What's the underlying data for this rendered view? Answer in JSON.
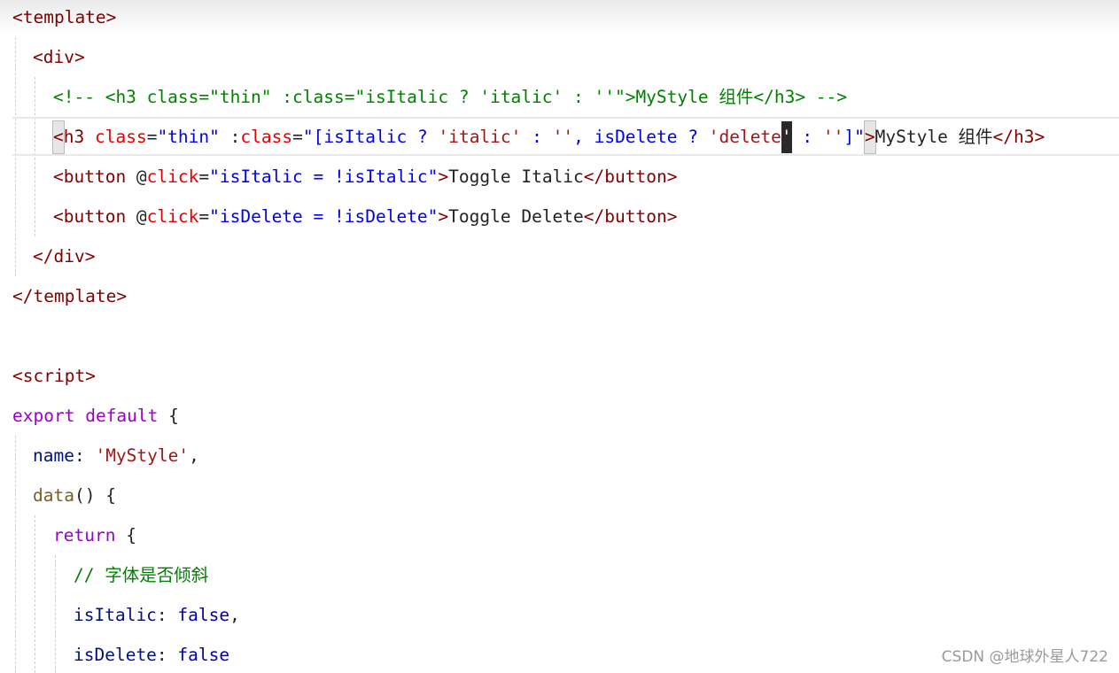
{
  "code": {
    "line1": "<template>",
    "line2": "<div>",
    "line3": "<!-- <h3 class=\"thin\" :class=\"isItalic ? 'italic' : ''\">MyStyle 组件</h3> -->",
    "line4": {
      "open_bracket": "<",
      "tag": "h3",
      "space": " ",
      "attr_class": "class",
      "eq1": "=",
      "val_thin": "\"thin\"",
      "space2": " ",
      "colon": ":",
      "attr_bind": "class",
      "eq2": "=",
      "val_open": "\"[isItalic ? ",
      "str_italic": "'italic'",
      "mid1": " : ",
      "str_empty1": "''",
      "mid2": ", isDelete ? ",
      "str_delete": "'delete",
      "cursor_char": "'",
      "mid3": " : ",
      "str_empty2": "''",
      "val_close": "]\"",
      "close_bracket": ">",
      "text": "MyStyle 组件",
      "end_tag": "</h3>"
    },
    "line5": {
      "open": "<button ",
      "at": "@",
      "attr": "click",
      "eq": "=",
      "val": "\"isItalic = !isItalic\"",
      "gt": ">",
      "text": "Toggle Italic",
      "close": "</button>"
    },
    "line6": {
      "open": "<button ",
      "at": "@",
      "attr": "click",
      "eq": "=",
      "val": "\"isDelete = !isDelete\"",
      "gt": ">",
      "text": "Toggle Delete",
      "close": "</button>"
    },
    "line7": "</div>",
    "line8": "</template>",
    "line9": "<script>",
    "line10": {
      "kw1": "export",
      "kw2": "default",
      "brace": " {"
    },
    "line11": {
      "key": "name",
      "colon": ": ",
      "val": "'MyStyle'",
      "comma": ","
    },
    "line12": {
      "fn": "data",
      "rest": "() {"
    },
    "line13": {
      "kw": "return",
      "brace": " {"
    },
    "line14": "// 字体是否倾斜",
    "line15": {
      "key": "isItalic",
      "colon": ": ",
      "val": "false",
      "comma": ","
    },
    "line16": {
      "key": "isDelete",
      "colon": ": ",
      "val": "false"
    }
  },
  "watermark": "CSDN @地球外星人722",
  "colors": {
    "tag": "#800000",
    "attribute": "#e50000",
    "string": "#0000ee",
    "comment": "#008000",
    "keyword": "#9900cc",
    "boolean": "#0000aa"
  }
}
